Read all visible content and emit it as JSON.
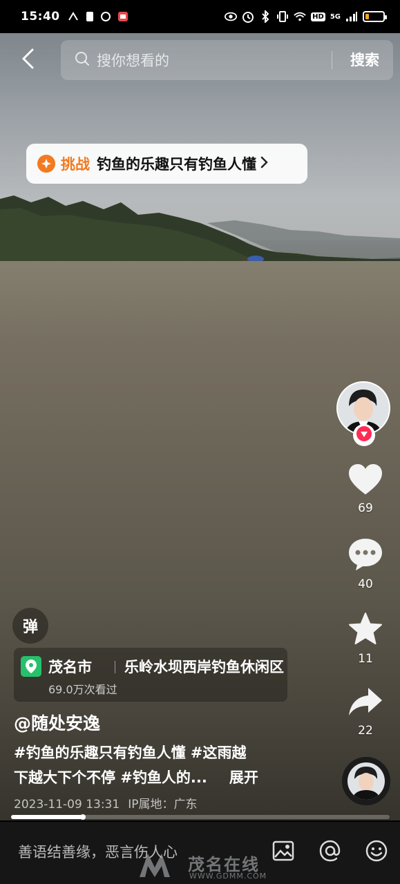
{
  "status_bar": {
    "time": "15:40",
    "network": "5G",
    "hd": "HD"
  },
  "search": {
    "placeholder": "搜你想看的",
    "button": "搜索"
  },
  "challenge": {
    "tag": "挑战",
    "title": "钓鱼的乐趣只有钓鱼人懂"
  },
  "rail": {
    "likes": "69",
    "comments": "40",
    "favorites": "11",
    "shares": "22"
  },
  "danmu_label": "弹",
  "location": {
    "city": "茂名市",
    "place": "乐岭水坝西岸钓鱼休闲区",
    "views": "69.0万次看过"
  },
  "author": "@随处安逸",
  "caption": {
    "line1": "#钓鱼的乐趣只有钓鱼人懂 #这雨越",
    "line2": "下越大下个不停 #钓鱼人的...",
    "expand": "展开"
  },
  "meta": {
    "date": "2023-11-09 13:31",
    "ip": "IP属地：广东"
  },
  "progress": 0.19,
  "comment_placeholder": "善语结善缘，恶言伤人心",
  "watermark": {
    "text": "茂名在线",
    "url": "WWW.GDMM.COM"
  },
  "icons": [
    "back-arrow-icon",
    "search-icon",
    "star-badge-icon",
    "heart-icon",
    "comment-icon",
    "star-icon",
    "share-icon",
    "location-pin-icon",
    "image-icon",
    "at-icon",
    "emoji-icon"
  ],
  "colors": {
    "accent_orange": "#f47a20",
    "location_green": "#27c06b",
    "follow_red": "#fe2c55"
  }
}
